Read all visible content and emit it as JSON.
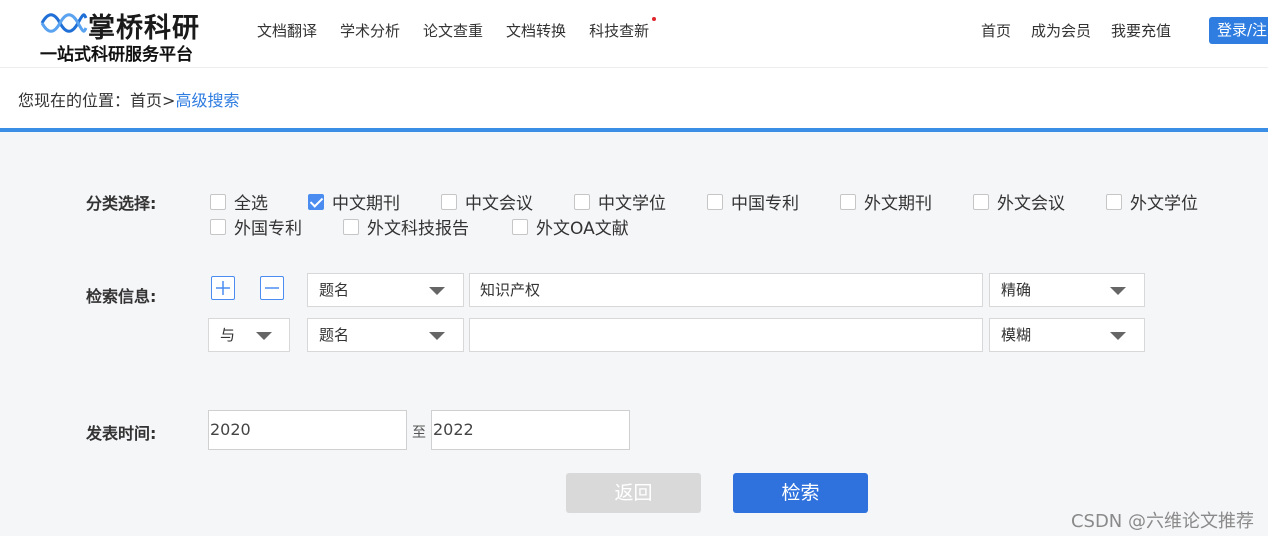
{
  "header": {
    "logo_name": "掌桥科研",
    "logo_slogan": "一站式科研服务平台",
    "nav": [
      "文档翻译",
      "学术分析",
      "论文查重",
      "文档转换",
      "科技查新"
    ],
    "right_nav": [
      "首页",
      "成为会员",
      "我要充值"
    ],
    "login_label": "登录/注"
  },
  "breadcrumb": {
    "prefix": "您现在的位置：",
    "home": "首页",
    "sep": ">",
    "current": "高级搜索"
  },
  "category": {
    "label": "分类选择:",
    "options": [
      {
        "label": "全选",
        "checked": false
      },
      {
        "label": "中文期刊",
        "checked": true
      },
      {
        "label": "中文会议",
        "checked": false
      },
      {
        "label": "中文学位",
        "checked": false
      },
      {
        "label": "中国专利",
        "checked": false
      },
      {
        "label": "外文期刊",
        "checked": false
      },
      {
        "label": "外文会议",
        "checked": false
      },
      {
        "label": "外文学位",
        "checked": false
      },
      {
        "label": "外国专利",
        "checked": false
      },
      {
        "label": "外文科技报告",
        "checked": false
      },
      {
        "label": "外文OA文献",
        "checked": false
      }
    ]
  },
  "search": {
    "label": "检索信息:",
    "rows": [
      {
        "field": "题名",
        "value": "知识产权",
        "match": "精确"
      },
      {
        "logic": "与",
        "field": "题名",
        "value": "",
        "match": "模糊"
      }
    ]
  },
  "time": {
    "label": "发表时间:",
    "from": "2020",
    "to_label": "至",
    "to": "2022"
  },
  "buttons": {
    "back": "返回",
    "search": "检索"
  },
  "watermark": "CSDN @六维论文推荐",
  "colors": {
    "accent": "#2f7de1",
    "search_button": "#2f72dd",
    "back_button": "#d9d9d9",
    "checkbox_checked": "#4a8cf0"
  }
}
